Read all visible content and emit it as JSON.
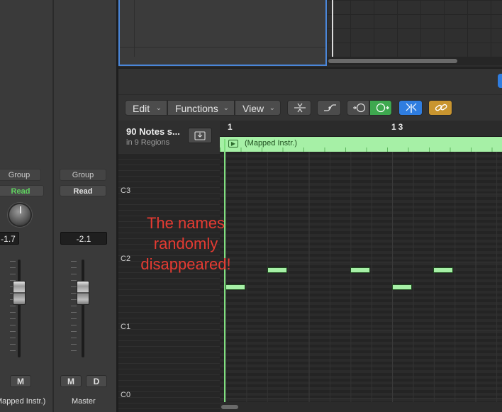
{
  "mixer": {
    "strips": [
      {
        "group": "Group",
        "automation": "Read",
        "volume": "-1.7",
        "buttons": [
          "M"
        ],
        "name": "Mapped Instr.)"
      },
      {
        "group": "Group",
        "automation": "Read",
        "volume": "-2.1",
        "buttons": [
          "M",
          "D"
        ],
        "name": "Master"
      }
    ],
    "automation_color": "#5fd35f"
  },
  "editor": {
    "menus": [
      {
        "label": "Edit"
      },
      {
        "label": "Functions"
      },
      {
        "label": "View"
      }
    ],
    "tools": [
      "collapse-icon",
      "automation-curve-icon",
      "midi-in-icon",
      "midi-out-icon",
      "catch-icon",
      "link-icon"
    ],
    "region": {
      "title": "90 Notes s...",
      "subtitle": "in 9 Regions",
      "name": "(Mapped Instr.)"
    },
    "ruler": [
      "1",
      "13"
    ],
    "keyboard_labels": [
      "C3",
      "C2",
      "C1",
      "C0"
    ],
    "region_color": "#a6f0a6",
    "accent_blue": "#2f7de0",
    "accent_gold": "#c9952f"
  },
  "annotation": {
    "line1": "The names",
    "line2": "randomly",
    "line3": "disappeared!",
    "color": "#e53b32"
  }
}
